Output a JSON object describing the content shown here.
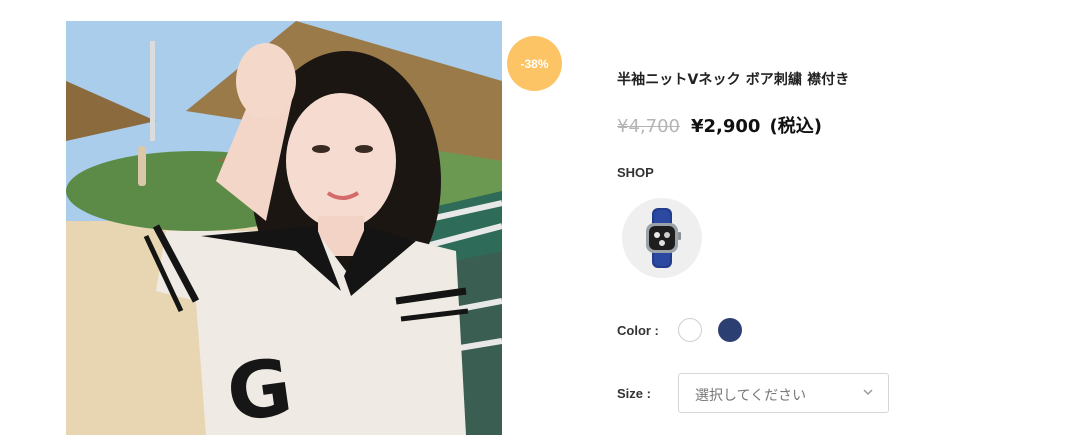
{
  "product": {
    "discount_badge": "-38%",
    "title": "半袖ニットVネック ボア刺繍 襟付き",
    "old_price": "¥4,700",
    "new_price": "¥2,900",
    "tax_note": "(税込)",
    "photo_icon": "product-photo-woman-knit-top"
  },
  "shop": {
    "label": "SHOP",
    "thumbnail_icon": "watch-icon"
  },
  "options": {
    "color_label": "Color :",
    "colors": [
      {
        "name": "white-swatch",
        "hex": "#ffffff"
      },
      {
        "name": "navy-swatch",
        "hex": "#2c3f73"
      }
    ],
    "size_label": "Size :",
    "size_placeholder": "選択してください"
  },
  "accent_colors": {
    "badge": "#fcc464",
    "navy": "#2c3f73"
  }
}
